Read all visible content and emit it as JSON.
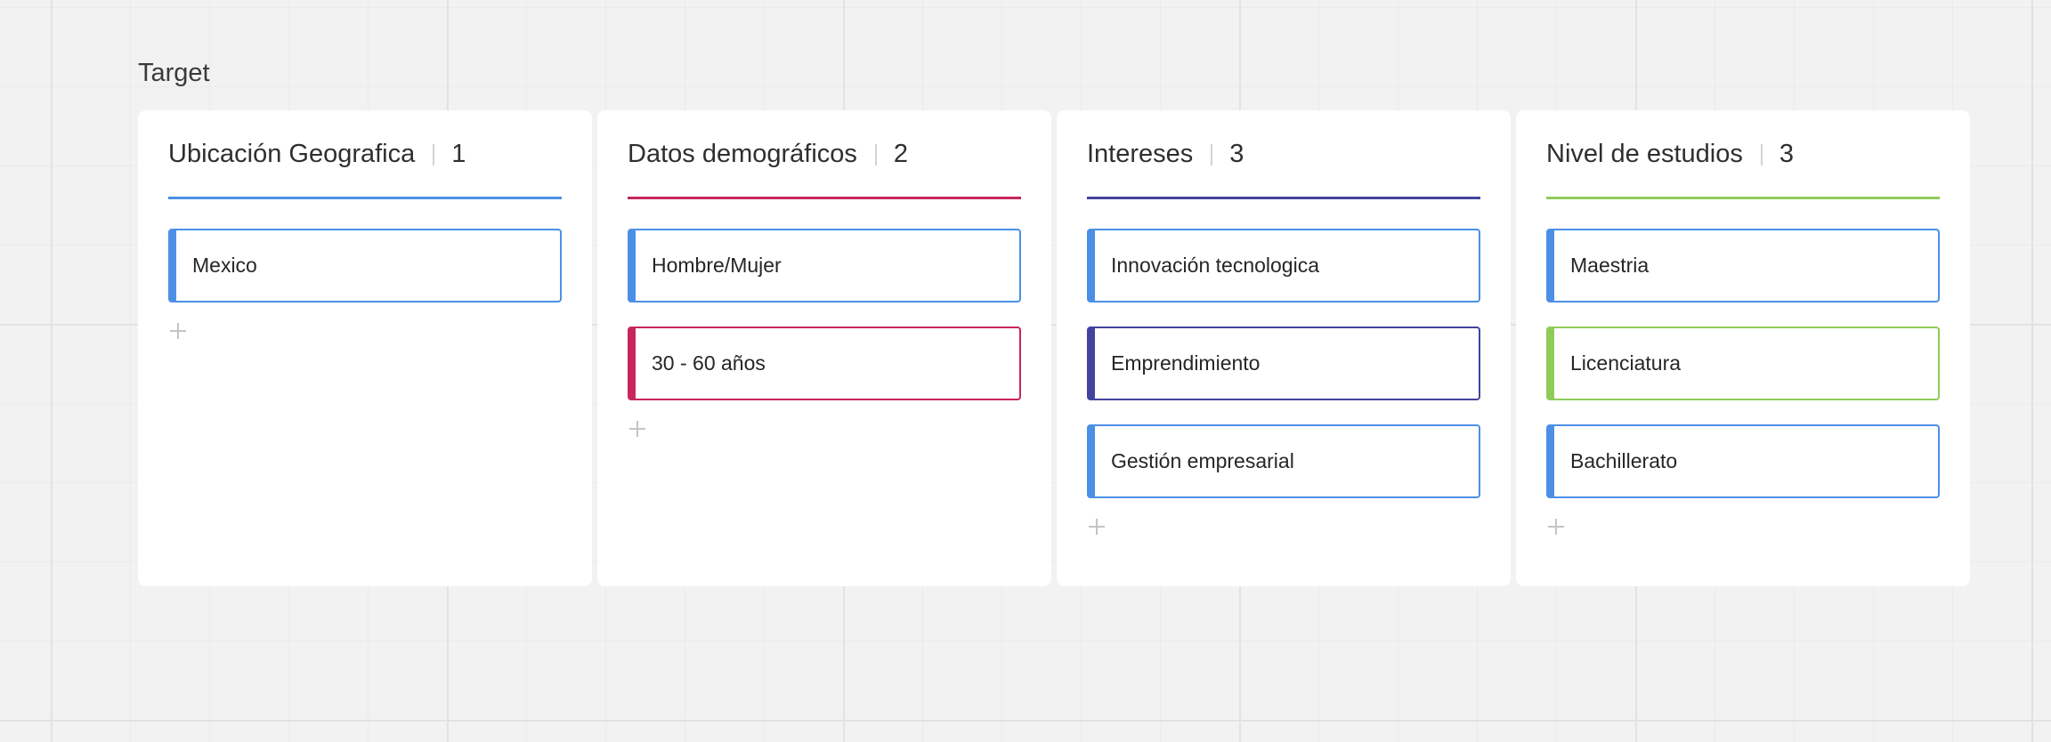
{
  "board": {
    "title": "Target"
  },
  "columns": [
    {
      "title": "Ubicación Geografica",
      "count": "1",
      "color": "#4b90e6",
      "cards": [
        {
          "text": "Mexico",
          "color": "#4b90e6"
        }
      ]
    },
    {
      "title": "Datos demográficos",
      "count": "2",
      "color": "#c7275e",
      "cards": [
        {
          "text": "Hombre/Mujer",
          "color": "#4b90e6"
        },
        {
          "text": "30 - 60 años",
          "color": "#c7275e"
        }
      ]
    },
    {
      "title": "Intereses",
      "count": "3",
      "color": "#43439e",
      "cards": [
        {
          "text": "Innovación tecnologica",
          "color": "#4b90e6"
        },
        {
          "text": "Emprendimiento",
          "color": "#43439e"
        },
        {
          "text": "Gestión empresarial",
          "color": "#4b90e6"
        }
      ]
    },
    {
      "title": "Nivel de estudios",
      "count": "3",
      "color": "#8fcb5a",
      "cards": [
        {
          "text": "Maestria",
          "color": "#4b90e6"
        },
        {
          "text": "Licenciatura",
          "color": "#8fcb5a"
        },
        {
          "text": "Bachillerato",
          "color": "#4b90e6"
        }
      ]
    }
  ],
  "icons": {
    "add": "plus-icon"
  }
}
